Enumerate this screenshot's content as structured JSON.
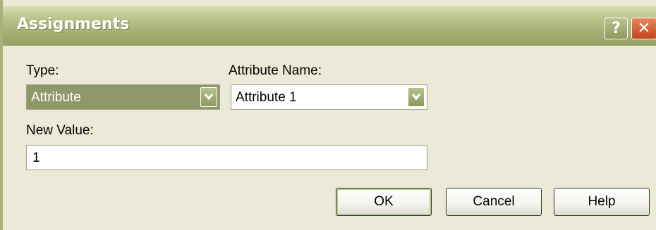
{
  "window": {
    "title": "Assignments",
    "help_glyph": "?",
    "close_glyph": "✕"
  },
  "form": {
    "type_label": "Type:",
    "type_value": "Attribute",
    "attribute_name_label": "Attribute Name:",
    "attribute_name_value": "Attribute 1",
    "new_value_label": "New Value:",
    "new_value_value": "1"
  },
  "buttons": {
    "ok": "OK",
    "cancel": "Cancel",
    "help": "Help"
  },
  "icons": {
    "dropdown": "chevron-down-icon",
    "help": "question-icon",
    "close": "close-icon"
  },
  "colors": {
    "titlebar": "#a3ad71",
    "dialog_bg": "#ece9d8",
    "selection": "#8e9869",
    "close_button": "#c44217"
  }
}
